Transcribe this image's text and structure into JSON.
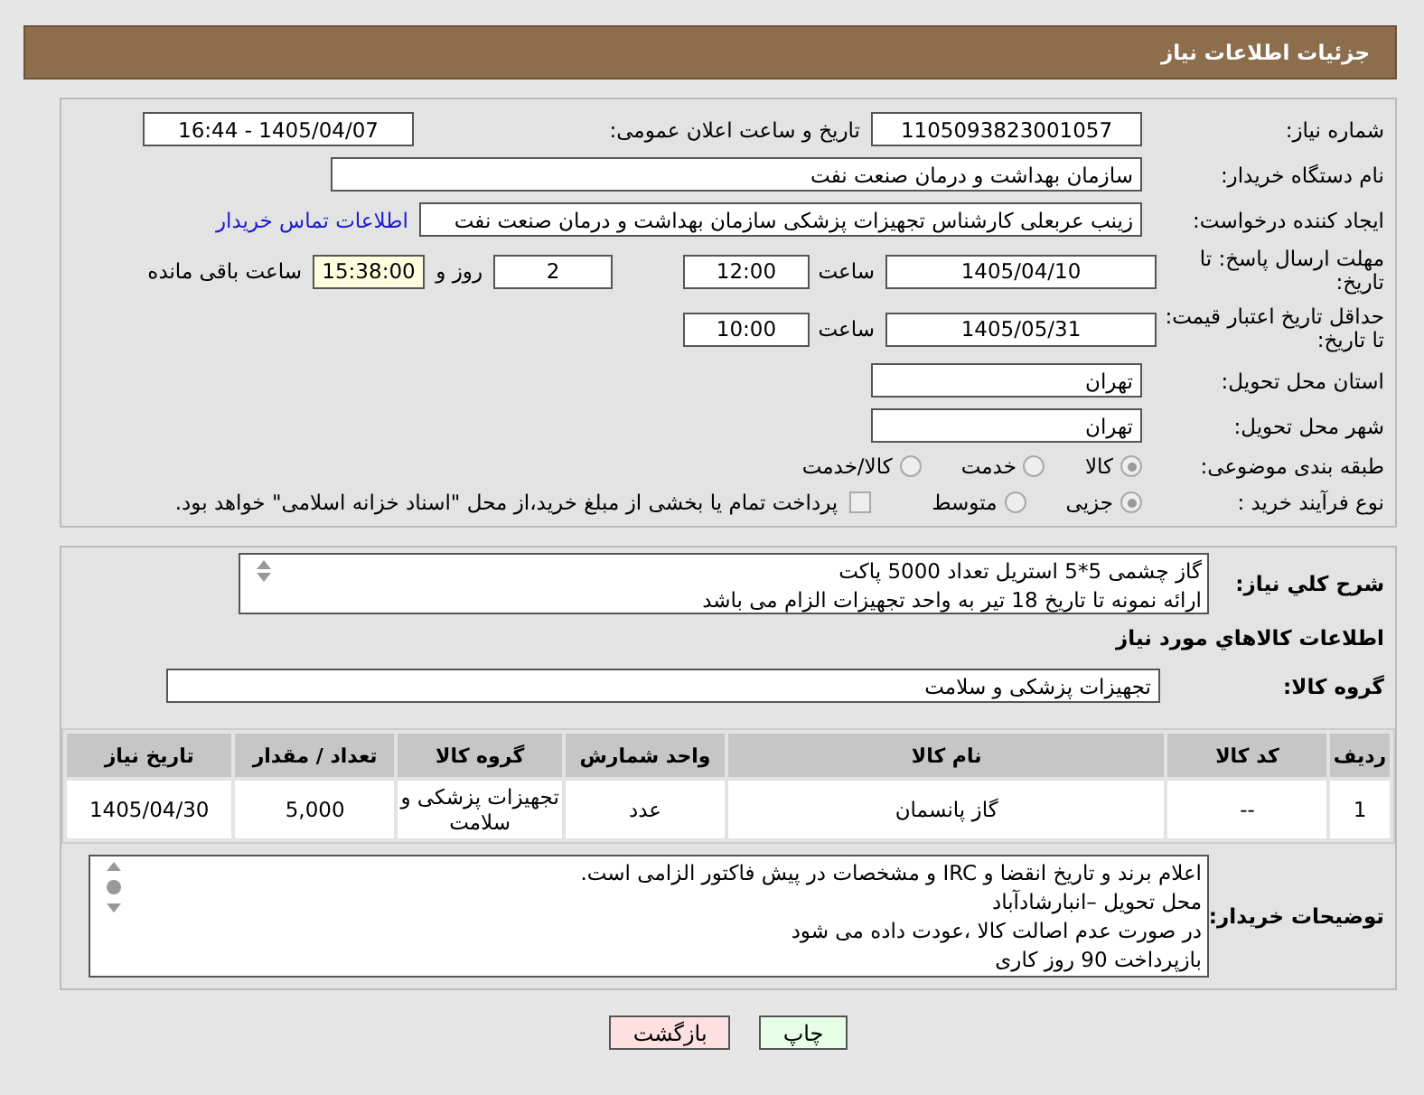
{
  "header": {
    "title": "جزئیات اطلاعات نیاز"
  },
  "need_info": {
    "need_number": {
      "label": "شماره نیاز:",
      "value": "1105093823001057"
    },
    "announce_datetime": {
      "label": "تاریخ و ساعت اعلان عمومی:",
      "value": "1405/04/07 - 16:44"
    },
    "buyer_org": {
      "label": "نام دستگاه خریدار:",
      "value": "سازمان بهداشت و درمان صنعت نفت"
    },
    "requester": {
      "label": "ایجاد کننده درخواست:",
      "value": "زینب عربعلی کارشناس تجهیزات پزشکی سازمان بهداشت و درمان صنعت نفت",
      "link": "اطلاعات تماس خریدار"
    },
    "response_deadline": {
      "label": "مهلت ارسال پاسخ: تا تاریخ:",
      "date": "1405/04/10",
      "time_label": "ساعت",
      "time": "12:00",
      "days": "2",
      "days_label": "روز و",
      "remaining": "15:38:00",
      "remaining_label": "ساعت باقی مانده"
    },
    "price_validity": {
      "label": "حداقل تاریخ اعتبار قیمت: تا تاریخ:",
      "date": "1405/05/31",
      "time_label": "ساعت",
      "time": "10:00"
    },
    "delivery_province": {
      "label": "استان محل تحویل:",
      "value": "تهران"
    },
    "delivery_city": {
      "label": "شهر محل تحویل:",
      "value": "تهران"
    },
    "category": {
      "label": "طبقه بندی موضوعی:",
      "options": [
        {
          "label": "کالا",
          "selected": true
        },
        {
          "label": "خدمت",
          "selected": false
        },
        {
          "label": "کالا/خدمت",
          "selected": false
        }
      ]
    },
    "purchase_type": {
      "label": "نوع فرآیند خرید :",
      "options": [
        {
          "label": "جزیی",
          "selected": true
        },
        {
          "label": "متوسط",
          "selected": false
        }
      ],
      "treasury_payment": {
        "label": "پرداخت تمام یا بخشی از مبلغ خرید،از محل \"اسناد خزانه اسلامی\" خواهد بود.",
        "checked": false
      }
    }
  },
  "items_panel": {
    "description": {
      "label": "شرح کلي نياز:",
      "lines": [
        "گاز چشمی 5*5 استریل  تعداد 5000 پاکت",
        "ارائه نمونه تا تاریخ 18 تیر به واحد تجهیزات  الزام می باشد"
      ]
    },
    "heading": "اطلاعات كالاهاي مورد نياز",
    "goods_group": {
      "label": "گروه کالا:",
      "value": "تجهیزات پزشکی و سلامت"
    },
    "table": {
      "columns": [
        "ردیف",
        "کد کالا",
        "نام کالا",
        "واحد شمارش",
        "گروه کالا",
        "تعداد / مقدار",
        "تاریخ نیاز"
      ],
      "rows": [
        [
          "1",
          "--",
          "گاز پانسمان",
          "عدد",
          "تجهیزات پزشکی و سلامت",
          "5,000",
          "1405/04/30"
        ]
      ]
    },
    "buyer_notes": {
      "label": "توضیحات خریدار:",
      "lines": [
        "اعلام برند و تاریخ انقضا  و IRC  و مشخصات  در پیش فاکتور الزامی است.",
        "محل تحویل –انبارشادآباد",
        "در صورت عدم اصالت کالا ،عودت داده می شود",
        "بازپرداخت 90 روز کاری"
      ]
    }
  },
  "buttons": [
    {
      "label": "چاپ",
      "kind": "print"
    },
    {
      "label": "بازگشت",
      "kind": "back"
    }
  ]
}
